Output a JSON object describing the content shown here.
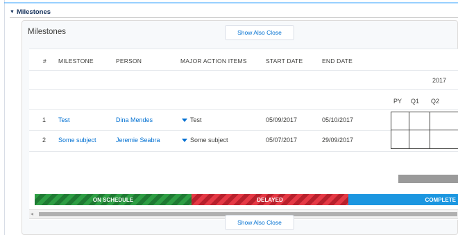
{
  "section": {
    "title": "Milestones"
  },
  "card": {
    "title": "Milestones",
    "show_also_close_top": "Show Also Close",
    "show_also_close_bottom": "Show Also Close"
  },
  "table": {
    "headers": [
      "#",
      "MILESTONE",
      "PERSON",
      "MAJOR ACTION ITEMS",
      "START DATE",
      "END DATE"
    ],
    "year": "2017",
    "quarters": [
      "PY",
      "Q1",
      "Q2"
    ],
    "rows": [
      {
        "num": "1",
        "milestone": "Test",
        "person": "Dina Mendes",
        "action": "Test",
        "start": "05/09/2017",
        "end": "05/10/2017"
      },
      {
        "num": "2",
        "milestone": "Some subject",
        "person": "Jeremie Seabra",
        "action": "Some subject",
        "start": "05/07/2017",
        "end": "29/09/2017"
      }
    ]
  },
  "status_legend": {
    "on_schedule": "ON SCHEDULE",
    "delayed": "DELAYED",
    "complete": "COMPLETE"
  },
  "colors": {
    "link": "#0070d2",
    "on_schedule": "#2e9e44",
    "delayed": "#e53945",
    "complete": "#1b96e0"
  }
}
